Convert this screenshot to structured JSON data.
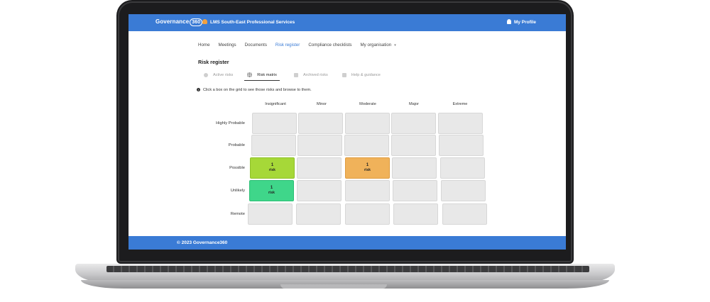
{
  "header": {
    "brand": "Governance",
    "brand_badge": "360",
    "organisation": "LMS South-East Professional Services",
    "profile_label": "My Profile",
    "accent_color": "#3a7bd5"
  },
  "nav": {
    "items": [
      "Home",
      "Meetings",
      "Documents",
      "Risk register",
      "Compliance checklists",
      "My organisation"
    ],
    "active": "Risk register"
  },
  "page": {
    "title": "Risk register",
    "subtabs": [
      "Active risks",
      "Risk matrix",
      "Archived risks",
      "Help & guidance"
    ],
    "active_subtab": "Risk matrix",
    "info": "Click a box on the grid to see those risks and browse to them."
  },
  "matrix": {
    "columns": [
      "Insignificant",
      "Minor",
      "Moderate",
      "Major",
      "Extreme"
    ],
    "rows": [
      "Highly Probable",
      "Probable",
      "Possible",
      "Unlikely",
      "Remote"
    ],
    "cells": {
      "possible_insignificant": {
        "count": "1",
        "label": "risk",
        "color": "#a6d838"
      },
      "possible_moderate": {
        "count": "1",
        "label": "risk",
        "color": "#f0b25a"
      },
      "unlikely_insignificant": {
        "count": "1",
        "label": "risk",
        "color": "#3fd68a"
      }
    }
  },
  "footer": {
    "text": "© 2023 Governance360"
  }
}
